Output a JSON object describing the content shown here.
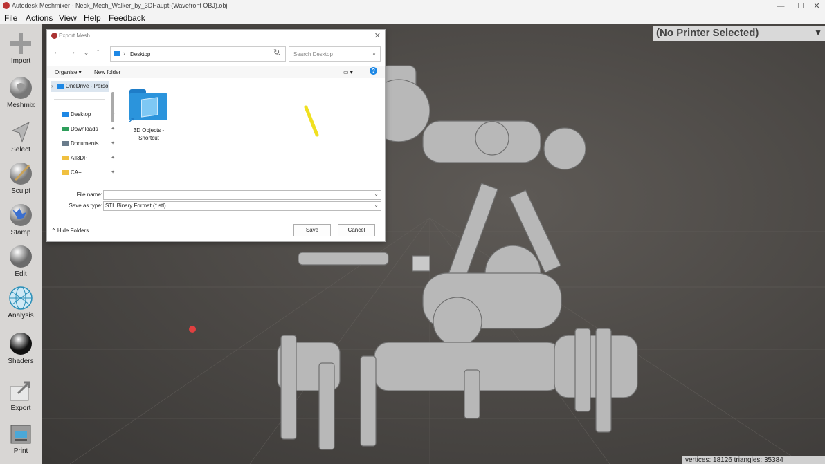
{
  "window": {
    "title": "Autodesk Meshmixer - Neck_Mech_Walker_by_3DHaupt-(Wavefront OBJ).obj",
    "minimize": "—",
    "maximize": "☐",
    "close": "✕"
  },
  "menu": {
    "file": "File",
    "actions": "Actions",
    "view": "View",
    "help": "Help",
    "feedback": "Feedback"
  },
  "tools": {
    "import": "Import",
    "meshmix": "Meshmix",
    "select": "Select",
    "sculpt": "Sculpt",
    "stamp": "Stamp",
    "edit": "Edit",
    "analysis": "Analysis",
    "shaders": "Shaders",
    "export": "Export",
    "print": "Print"
  },
  "printer": {
    "label": "(No Printer Selected)",
    "dropdown": "▼"
  },
  "status": {
    "stats": "vertices: 18126 triangles: 35384"
  },
  "dialog": {
    "title": "Export Mesh",
    "close": "✕",
    "nav": {
      "back": "←",
      "forward": "→",
      "recent": "⌄",
      "up": "↑"
    },
    "address": {
      "chevron": "›",
      "location": "Desktop",
      "dropdown": "⌄"
    },
    "refresh": "↻",
    "search": {
      "placeholder": "Search Desktop",
      "icon": "⌕"
    },
    "commands": {
      "organise": "Organise ▾",
      "new_folder": "New folder",
      "view_icon": "▭ ▾",
      "help": "?"
    },
    "nav_pane": [
      {
        "label": "OneDrive - Perso",
        "expander": "›",
        "color": "#1e88e5"
      },
      {
        "label": "Desktop",
        "pin": "📌",
        "color": "#1e88e5"
      },
      {
        "label": "Downloads",
        "pin": "📌",
        "color": "#2e9e5b"
      },
      {
        "label": "Documents",
        "pin": "📌",
        "color": "#6a7c8c"
      },
      {
        "label": "All3DP",
        "pin": "📌",
        "color": "#f0c040"
      },
      {
        "label": "CA+",
        "pin": "📌",
        "color": "#f0c040"
      }
    ],
    "items": [
      {
        "label": "3D Objects - Shortcut",
        "shortcut_arrow": "↗"
      }
    ],
    "file_name": {
      "label": "File name:",
      "value": "",
      "dropdown": "⌄"
    },
    "save_as_type": {
      "label": "Save as type:",
      "value": "STL Binary Format (*.stl)",
      "dropdown": "⌄"
    },
    "hide_folders": "⌃ Hide Folders",
    "save": "Save",
    "cancel": "Cancel"
  }
}
